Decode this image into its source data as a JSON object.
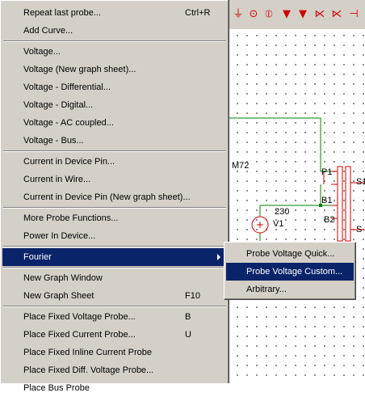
{
  "context_menu": {
    "groups": [
      [
        {
          "label": "Repeat last probe...",
          "shortcut": "Ctrl+R"
        },
        {
          "label": "Add Curve..."
        }
      ],
      [
        {
          "label": "Voltage..."
        },
        {
          "label": "Voltage (New graph sheet)..."
        },
        {
          "label": "Voltage - Differential..."
        },
        {
          "label": "Voltage - Digital..."
        },
        {
          "label": "Voltage - AC coupled..."
        },
        {
          "label": "Voltage - Bus..."
        }
      ],
      [
        {
          "label": "Current in Device Pin..."
        },
        {
          "label": "Current in Wire..."
        },
        {
          "label": "Current in Device Pin (New graph sheet)..."
        }
      ],
      [
        {
          "label": "More Probe Functions..."
        },
        {
          "label": "Power In Device..."
        }
      ],
      [
        {
          "label": "Fourier",
          "submenu": true,
          "highlighted": true
        }
      ],
      [
        {
          "label": "New Graph Window"
        },
        {
          "label": "New Graph Sheet",
          "shortcut": "F10"
        }
      ],
      [
        {
          "label": "Place Fixed Voltage Probe...",
          "shortcut": "B"
        },
        {
          "label": "Place Fixed Current Probe...",
          "shortcut": "U"
        },
        {
          "label": "Place Fixed Inline Current Probe"
        },
        {
          "label": "Place Fixed Diff. Voltage Probe..."
        },
        {
          "label": "Place Bus Probe"
        }
      ]
    ]
  },
  "fourier_submenu": {
    "items": [
      {
        "label": "Probe Voltage Quick..."
      },
      {
        "label": "Probe Voltage Custom...",
        "highlighted": true
      },
      {
        "label": "Arbitrary..."
      }
    ]
  },
  "schematic": {
    "labels": {
      "m72": "M72",
      "p1": "P1",
      "b1": "B1",
      "b2": "B2",
      "v_value": "230",
      "v1": "V1",
      "s1": "S1",
      "s2": "S"
    },
    "toolbar_icons": [
      "ground-icon",
      "meter-icon",
      "source-icon",
      "diode-icon",
      "diode-icon",
      "transistor-icon",
      "transistor-icon",
      "transistor-icon"
    ],
    "colors": {
      "wire": "#008000",
      "component": "#d00000",
      "menu_bg": "#d4d0c8",
      "highlight": "#0a246a"
    }
  }
}
